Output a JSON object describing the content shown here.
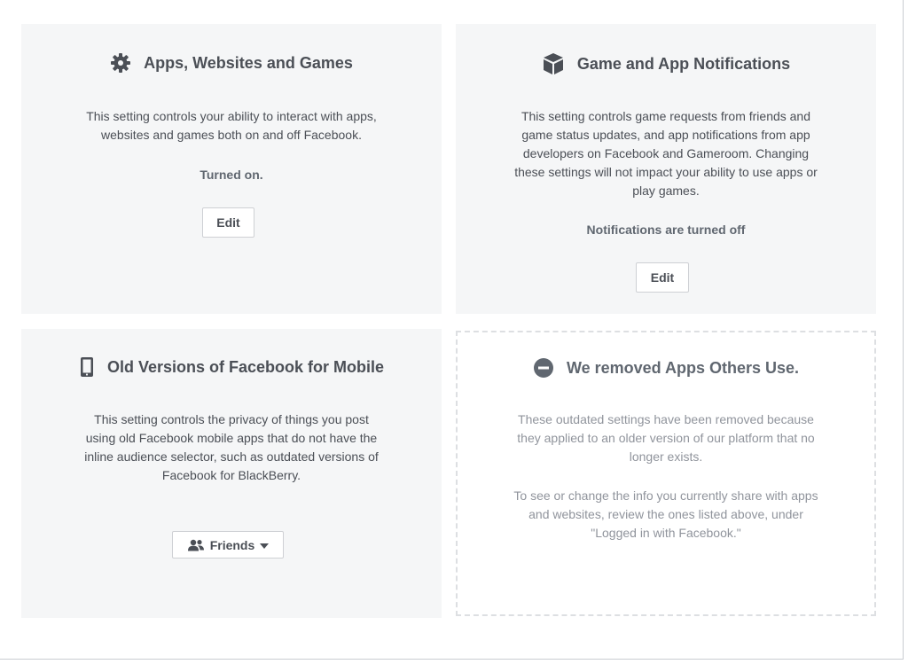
{
  "cards": {
    "apps": {
      "icon": "gear-icon",
      "title": "Apps, Websites and Games",
      "desc_lines": [
        "This setting controls your ability to interact with apps,",
        "websites and games both on and off Facebook."
      ],
      "status": "Turned on.",
      "button": "Edit"
    },
    "notifications": {
      "icon": "game-box-icon",
      "title": "Game and App Notifications",
      "desc_lines": [
        "This setting controls game requests from friends and",
        "game status updates, and app notifications from app",
        "developers on Facebook and Gameroom. Changing",
        "these settings will not impact your ability to use apps or",
        "play games."
      ],
      "status": "Notifications are turned off",
      "button": "Edit"
    },
    "mobile": {
      "icon": "mobile-phone-icon",
      "title": "Old Versions of Facebook for Mobile",
      "desc_lines": [
        "This setting controls the privacy of things you post",
        "using old Facebook mobile apps that do not have the",
        "inline audience selector, such as outdated versions of",
        "Facebook for BlackBerry."
      ],
      "selector": {
        "icon": "friends-icon",
        "selected": "Friends"
      }
    },
    "removed": {
      "icon": "minus-circle-icon",
      "title": "We removed Apps Others Use.",
      "desc_lines": [
        "These outdated settings have been removed because",
        "they applied to an older version of our platform that no",
        "longer exists."
      ],
      "desc2_lines": [
        "To see or change the info you currently share with apps",
        "and websites, review the ones listed above, under",
        "\"Logged in with Facebook.\""
      ]
    }
  },
  "colors": {
    "card_bg": "#f5f6f7",
    "title_text": "#4b4f56",
    "muted_text": "#90949c",
    "border": "#ced0d4"
  }
}
